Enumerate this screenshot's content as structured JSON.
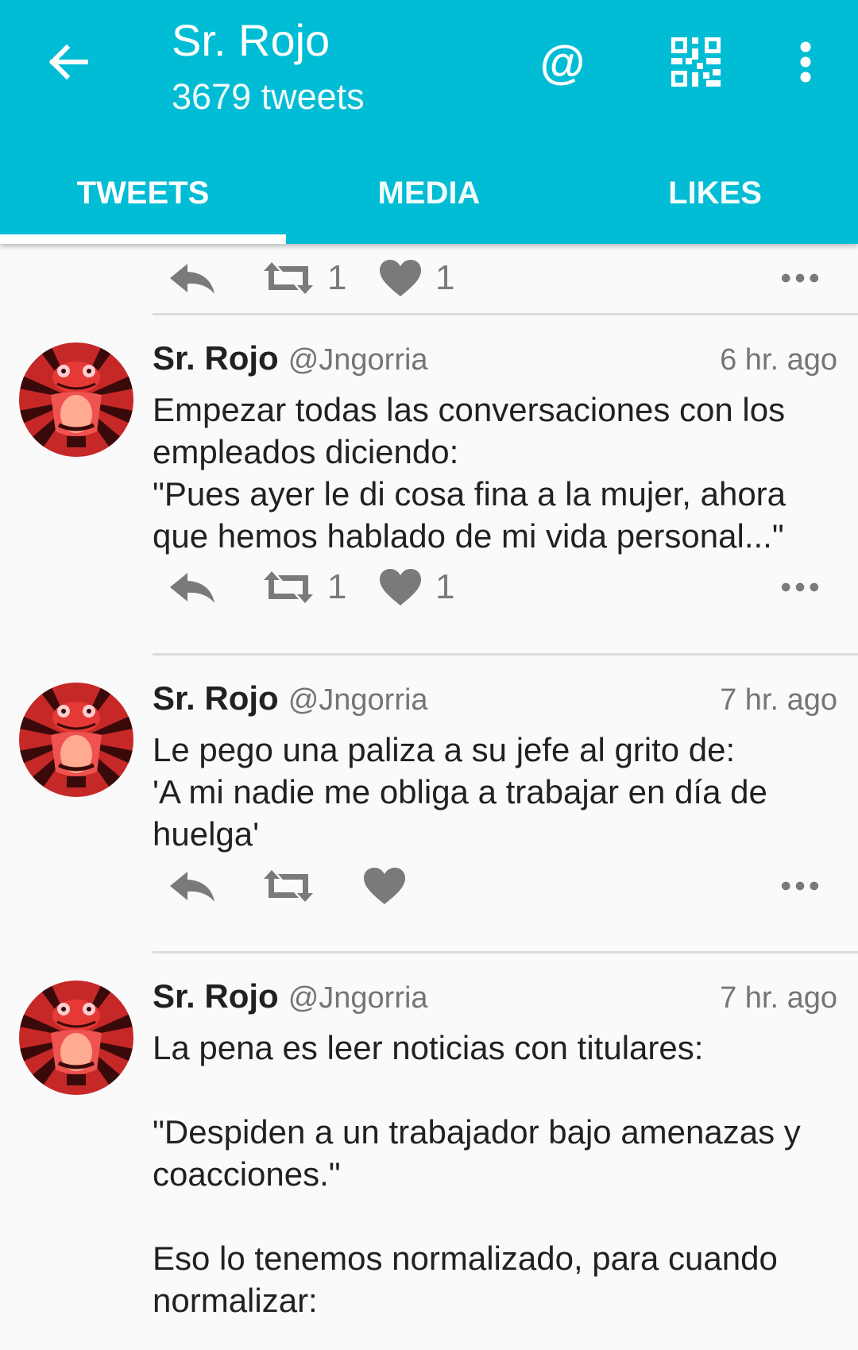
{
  "appbar": {
    "title": "Sr. Rojo",
    "subtitle": "3679 tweets",
    "mention_symbol": "@",
    "icons": [
      "back-arrow-icon",
      "at-icon",
      "qr-code-icon",
      "more-vert-icon"
    ]
  },
  "tabs": [
    {
      "label": "TWEETS",
      "active": true
    },
    {
      "label": "MEDIA",
      "active": false
    },
    {
      "label": "LIKES",
      "active": false
    }
  ],
  "colors": {
    "accent": "#00bcd4",
    "action_gray": "#7a7a7a",
    "avatar_red": "#d32f2f"
  },
  "top_partial_tweet": {
    "retweets": "1",
    "likes": "1"
  },
  "tweets": [
    {
      "name": "Sr. Rojo",
      "handle": "@Jngorria",
      "time": "6 hr. ago",
      "text": "Empezar todas las conversaciones con los empleados diciendo:\n\"Pues ayer le di cosa fina a la mujer, ahora que hemos hablado de mi vida personal...\"",
      "retweets": "1",
      "likes": "1"
    },
    {
      "name": "Sr. Rojo",
      "handle": "@Jngorria",
      "time": "7 hr. ago",
      "text": "Le pego una paliza a su jefe al grito de:\n'A mi nadie me obliga a trabajar en día de huelga'",
      "retweets": "",
      "likes": ""
    },
    {
      "name": "Sr. Rojo",
      "handle": "@Jngorria",
      "time": "7 hr. ago",
      "text": "La pena es leer noticias con titulares:\n\n\"Despiden a un trabajador bajo amenazas y coacciones.\"\n\nEso lo tenemos normalizado, para cuando normalizar:"
    }
  ]
}
